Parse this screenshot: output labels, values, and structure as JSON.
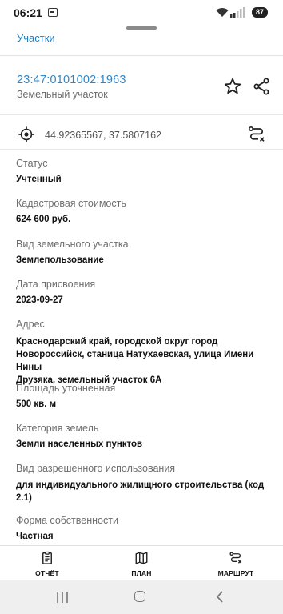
{
  "status_bar": {
    "time": "06:21",
    "battery": "87"
  },
  "header": {
    "tab_label": "Участки"
  },
  "parcel": {
    "cadastral_number": "23:47:0101002:1963",
    "type": "Земельный участок",
    "coordinates": "44.92365567, 37.5807162"
  },
  "fields": [
    {
      "label": "Статус",
      "value": "Учтенный"
    },
    {
      "label": "Кадастровая стоимость",
      "value": "624 600 руб."
    },
    {
      "label": "Вид земельного участка",
      "value": "Землепользование"
    },
    {
      "label": "Дата присвоения",
      "value": "2023-09-27"
    },
    {
      "label": "Адрес",
      "value_lines": [
        "Краснодарский край, городской округ город",
        "Новороссийск, станица Натухаевская, улица Имени Нины",
        "Друзяка, земельный участок 6А"
      ]
    },
    {
      "label": "Площадь уточненная",
      "value": "500 кв. м"
    },
    {
      "label": "Категория земель",
      "value": "Земли населенных пунктов"
    },
    {
      "label": "Вид разрешенного использования",
      "value_lines": [
        "для индивидуального жилищного строительства (код",
        "2.1)"
      ]
    },
    {
      "label": "Форма собственности",
      "value": "Частная"
    }
  ],
  "actions": [
    {
      "label": "ОТЧЁТ",
      "icon": "report-icon"
    },
    {
      "label": "ПЛАН",
      "icon": "map-icon"
    },
    {
      "label": "МАРШРУТ",
      "icon": "route-icon"
    }
  ]
}
